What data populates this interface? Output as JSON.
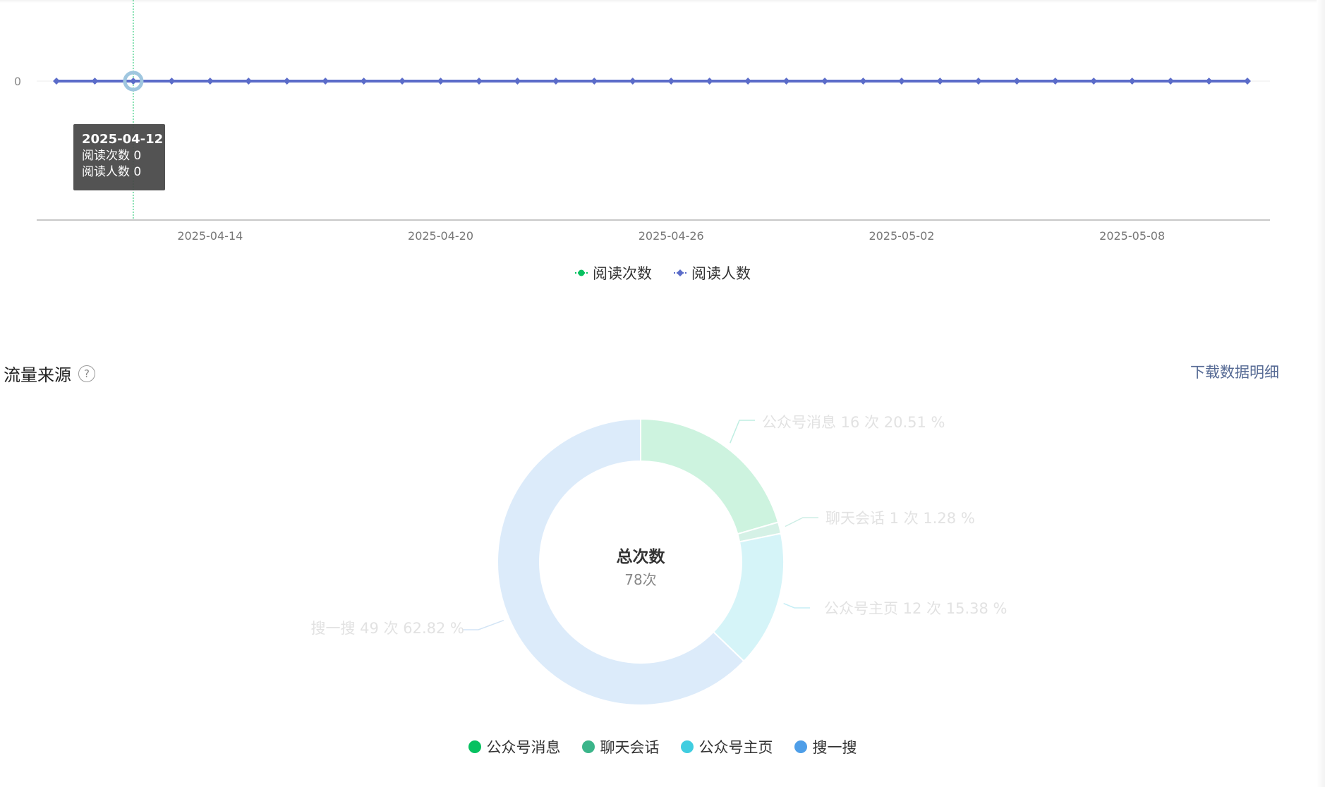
{
  "line_chart": {
    "tooltip": {
      "date": "2025-04-12",
      "lines": [
        "阅读次数 0",
        "阅读人数 0"
      ]
    },
    "legend": [
      {
        "label": "阅读次数",
        "color": "#07c160"
      },
      {
        "label": "阅读人数",
        "color": "#5b6cc9"
      }
    ]
  },
  "traffic": {
    "title": "流量来源",
    "help": "?",
    "download": "下载数据明细",
    "center_title": "总次数",
    "center_value": "78次",
    "legend": [
      {
        "label": "公众号消息",
        "color": "#07c160"
      },
      {
        "label": "聊天会话",
        "color": "#3bb58a"
      },
      {
        "label": "公众号主页",
        "color": "#40cde0"
      },
      {
        "label": "搜一搜",
        "color": "#4e9ee8"
      }
    ]
  },
  "chart_data": [
    {
      "type": "line",
      "x": [
        "2025-04-10",
        "2025-04-11",
        "2025-04-12",
        "2025-04-13",
        "2025-04-14",
        "2025-04-15",
        "2025-04-16",
        "2025-04-17",
        "2025-04-18",
        "2025-04-19",
        "2025-04-20",
        "2025-04-21",
        "2025-04-22",
        "2025-04-23",
        "2025-04-24",
        "2025-04-25",
        "2025-04-26",
        "2025-04-27",
        "2025-04-28",
        "2025-04-29",
        "2025-04-30",
        "2025-05-01",
        "2025-05-02",
        "2025-05-03",
        "2025-05-04",
        "2025-05-05",
        "2025-05-06",
        "2025-05-07",
        "2025-05-08",
        "2025-05-09",
        "2025-05-10",
        "2025-05-11"
      ],
      "xticks": [
        "2025-04-14",
        "2025-04-20",
        "2025-04-26",
        "2025-05-02",
        "2025-05-08"
      ],
      "yticks": [
        "0"
      ],
      "highlight": "2025-04-12",
      "series": [
        {
          "name": "阅读次数",
          "color": "#07c160",
          "values": [
            0,
            0,
            0,
            0,
            0,
            0,
            0,
            0,
            0,
            0,
            0,
            0,
            0,
            0,
            0,
            0,
            0,
            0,
            0,
            0,
            0,
            0,
            0,
            0,
            0,
            0,
            0,
            0,
            0,
            0,
            0,
            0
          ]
        },
        {
          "name": "阅读人数",
          "color": "#5b6cc9",
          "values": [
            0,
            0,
            0,
            0,
            0,
            0,
            0,
            0,
            0,
            0,
            0,
            0,
            0,
            0,
            0,
            0,
            0,
            0,
            0,
            0,
            0,
            0,
            0,
            0,
            0,
            0,
            0,
            0,
            0,
            0,
            0,
            0
          ]
        }
      ]
    },
    {
      "type": "pie",
      "slices": [
        {
          "label": "公众号消息",
          "value": 16,
          "percent": 20.51,
          "text": "公众号消息 16 次 20.51 %",
          "fill": "#cdf3df",
          "line": "#bfeee2"
        },
        {
          "label": "聊天会话",
          "value": 1,
          "percent": 1.28,
          "text": "聊天会话 1 次 1.28 %",
          "fill": "#d5f1e6",
          "line": "#cdeee6"
        },
        {
          "label": "公众号主页",
          "value": 12,
          "percent": 15.38,
          "text": "公众号主页 12 次 15.38 %",
          "fill": "#d5f4f8",
          "line": "#c6eef6"
        },
        {
          "label": "搜一搜",
          "value": 49,
          "percent": 62.82,
          "text": "搜一搜 49 次 62.82 %",
          "fill": "#dcebfa",
          "line": "#d2e4f5"
        }
      ],
      "total": 78
    }
  ]
}
